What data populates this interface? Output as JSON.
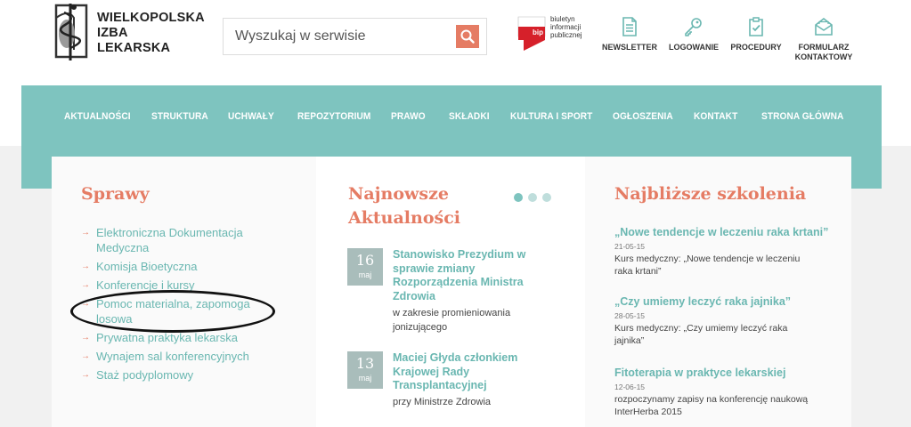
{
  "header": {
    "logo_lines": [
      "WIELKOPOLSKA",
      "IZBA",
      "LEKARSKA"
    ],
    "search_placeholder": "Wyszukaj w serwisie",
    "bip": {
      "mark": "bip",
      "lines": [
        "biuletyn",
        "informacji",
        "publicznej"
      ]
    },
    "icons": [
      {
        "label": "NEWSLETTER",
        "icon": "newsletter-icon"
      },
      {
        "label": "LOGOWANIE",
        "icon": "key-icon"
      },
      {
        "label": "PROCEDURY",
        "icon": "clipboard-check-icon"
      },
      {
        "label_lines": [
          "FORMULARZ",
          "KONTAKTOWY"
        ],
        "icon": "envelope-icon"
      }
    ]
  },
  "nav": {
    "items": [
      "AKTUALNOŚCI",
      "STRUKTURA",
      "UCHWAŁY",
      "REPOZYTORIUM",
      "PRAWO",
      "SKŁADKI",
      "KULTURA I SPORT",
      "OGŁOSZENIA",
      "KONTAKT",
      "STRONA GŁÓWNA"
    ]
  },
  "sprawy": {
    "title": "Sprawy",
    "items": [
      "Elektroniczna Dokumentacja Medyczna",
      "Komisja Bioetyczna",
      "Konferencje i kursy",
      "Pomoc materialna, zapomoga losowa",
      "Prywatna praktyka lekarska",
      "Wynajem sal konferencyjnych",
      "Staż podyplomowy"
    ]
  },
  "news": {
    "title_lines": [
      "Najnowsze",
      "Aktualności"
    ],
    "items": [
      {
        "day": "16",
        "month": "maj",
        "title": "Stanowisko Prezydium w sprawie zmiany Rozporządzenia Ministra Zdrowia",
        "desc": "w zakresie promieniowania jonizującego"
      },
      {
        "day": "13",
        "month": "maj",
        "title": "Maciej Głyda członkiem Krajowej Rady Transplantacyjnej",
        "desc": "przy Ministrze Zdrowia"
      }
    ]
  },
  "trainings": {
    "title": "Najbliższe szkolenia",
    "items": [
      {
        "title": "„Nowe tendencje w leczeniu raka krtani”",
        "date": "21-05-15",
        "desc": "Kurs medyczny: „Nowe tendencje w leczeniu raka krtani”"
      },
      {
        "title": "„Czy umiemy leczyć raka jajnika”",
        "date": "28-05-15",
        "desc": "Kurs medyczny: „Czy umiemy leczyć raka jajnika”"
      },
      {
        "title": "Fitoterapia w praktyce lekarskiej",
        "date": "12-06-15",
        "desc": "rozpoczynamy zapisy na konferencję naukową InterHerba 2015"
      }
    ]
  },
  "colors": {
    "teal": "#7ec4bf",
    "coral": "#e57c64",
    "link": "#6ab7b1"
  }
}
